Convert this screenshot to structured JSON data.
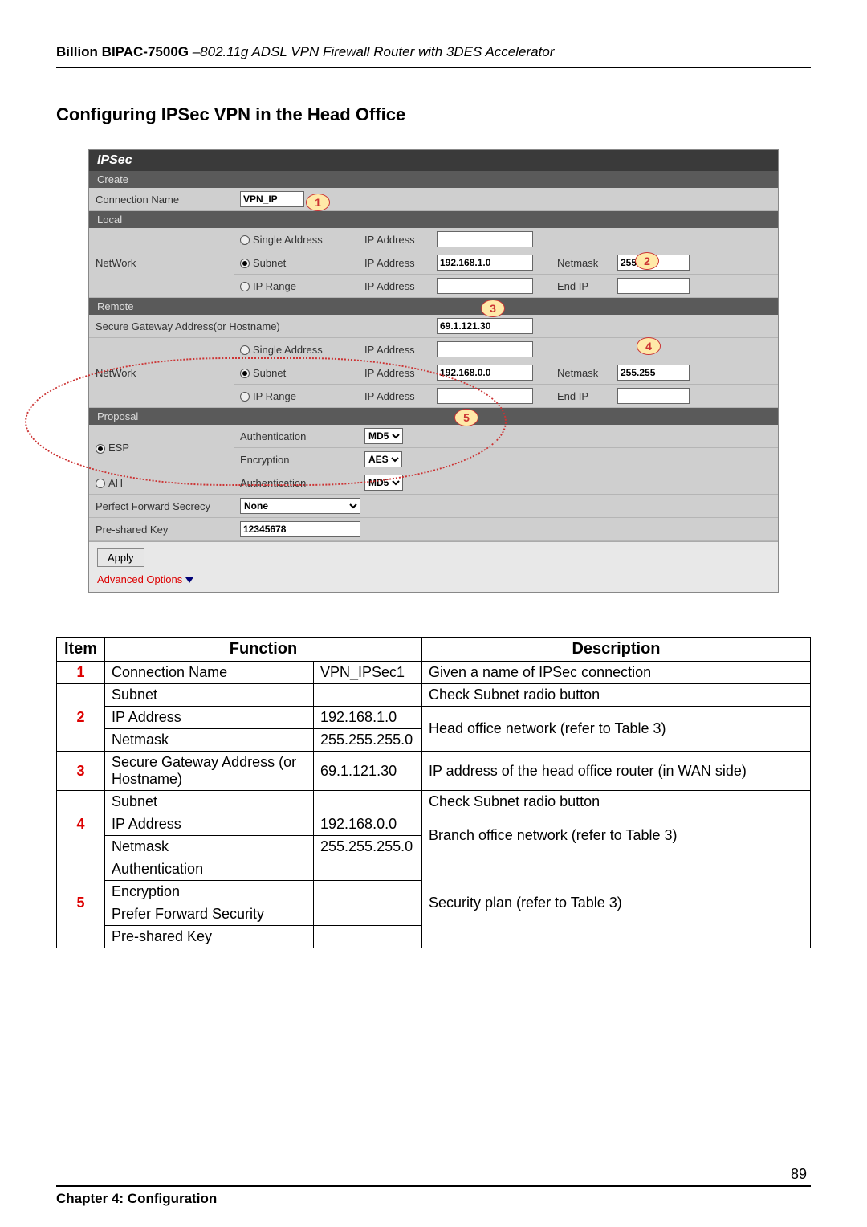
{
  "header": {
    "product": "Billion BIPAC-7500G",
    "desc": " –802.11g ADSL VPN Firewall Router with 3DES Accelerator"
  },
  "section_title": "Configuring IPSec VPN in the Head Office",
  "panel": {
    "title": "IPSec",
    "create": "Create",
    "conn_name_lbl": "Connection Name",
    "conn_name_val": "VPN_IP",
    "local": "Local",
    "network_lbl": "NetWork",
    "single_addr": "Single Address",
    "subnet": "Subnet",
    "ip_range": "IP Range",
    "ip_addr_lbl": "IP Address",
    "netmask_lbl": "Netmask",
    "endip_lbl": "End IP",
    "local_ip": "192.168.1.0",
    "local_mask": "255.25",
    "remote": "Remote",
    "sgw_lbl": "Secure Gateway Address(or Hostname)",
    "sgw_val": "69.1.121.30",
    "remote_ip": "192.168.0.0",
    "remote_mask": "255.255",
    "proposal": "Proposal",
    "esp": "ESP",
    "ah": "AH",
    "auth_lbl": "Authentication",
    "enc_lbl": "Encryption",
    "md5": "MD5",
    "aes": "AES",
    "pfs_lbl": "Perfect Forward Secrecy",
    "pfs_val": "None",
    "psk_lbl": "Pre-shared Key",
    "psk_val": "12345678",
    "apply": "Apply",
    "adv": "Advanced Options"
  },
  "callouts": {
    "c1": "1",
    "c2": "2",
    "c3": "3",
    "c4": "4",
    "c5": "5"
  },
  "desc_table": {
    "h_item": "Item",
    "h_func": "Function",
    "h_desc": "Description",
    "rows": [
      {
        "n": "1",
        "fn": "Connection Name",
        "val": "VPN_IPSec1",
        "desc": "Given a name of IPSec connection"
      },
      {
        "n": "2",
        "fn1": "Subnet",
        "val1": "",
        "desc1": "Check Subnet radio button",
        "fn2": "IP Address",
        "val2": "192.168.1.0",
        "desc2": "Head office network (refer to Table 3)",
        "fn3": "Netmask",
        "val3": "255.255.255.0"
      },
      {
        "n": "3",
        "fn": "Secure Gateway Address (or Hostname)",
        "val": "69.1.121.30",
        "desc": "IP address of the head office router (in WAN side)"
      },
      {
        "n": "4",
        "fn1": "Subnet",
        "val1": "",
        "desc1": "Check Subnet radio button",
        "fn2": "IP Address",
        "val2": "192.168.0.0",
        "desc2": "Branch office network (refer to Table 3)",
        "fn3": "Netmask",
        "val3": "255.255.255.0"
      },
      {
        "n": "5",
        "fn1": "Authentication",
        "fn2": "Encryption",
        "fn3": "Prefer Forward Security",
        "fn4": "Pre-shared Key",
        "desc": "Security plan (refer to Table 3)"
      }
    ]
  },
  "footer": {
    "page": "89",
    "chapter": "Chapter 4: Configuration"
  }
}
